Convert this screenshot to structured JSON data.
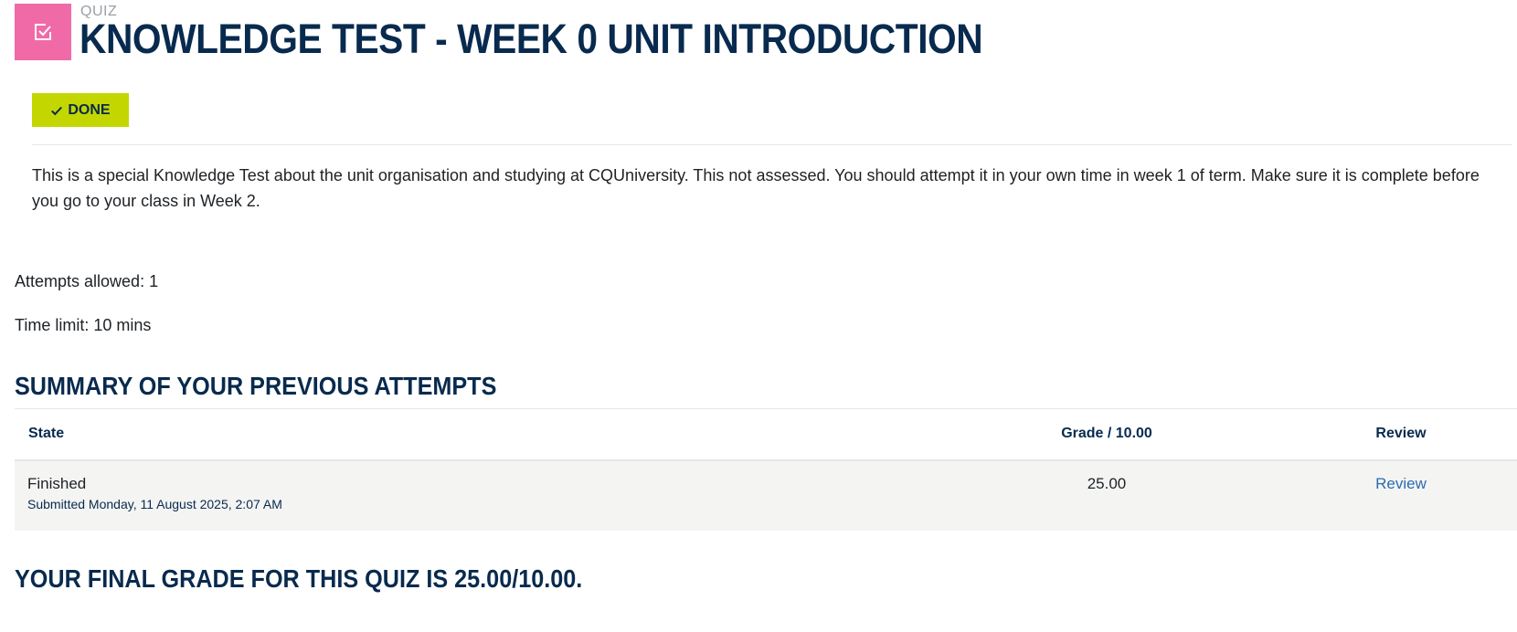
{
  "header": {
    "kind": "QUIZ",
    "title": "KNOWLEDGE TEST - WEEK 0 UNIT INTRODUCTION",
    "icon": "quiz-checkbox-icon",
    "icon_bg": "#f06aa7",
    "title_color": "#082a4e"
  },
  "completion": {
    "label": "DONE",
    "icon": "check-icon",
    "bg": "#c4d600"
  },
  "intro": {
    "text": "This is a special Knowledge Test about the unit organisation and studying at CQUniversity. This not assessed. You should attempt it in your own time in week 1 of term. Make sure it is complete before you go to your class in Week 2."
  },
  "quiz_info": {
    "attempts_allowed": "Attempts allowed: 1",
    "time_limit": "Time limit: 10 mins"
  },
  "summary": {
    "heading": "SUMMARY OF YOUR PREVIOUS ATTEMPTS",
    "columns": {
      "state": "State",
      "grade": "Grade / 10.00",
      "review": "Review"
    },
    "rows": [
      {
        "state": "Finished",
        "submitted": "Submitted Monday, 11 August 2025, 2:07 AM",
        "grade": "25.00",
        "review": "Review"
      }
    ]
  },
  "final_grade": {
    "text": "YOUR FINAL GRADE FOR THIS QUIZ IS 25.00/10.00."
  }
}
